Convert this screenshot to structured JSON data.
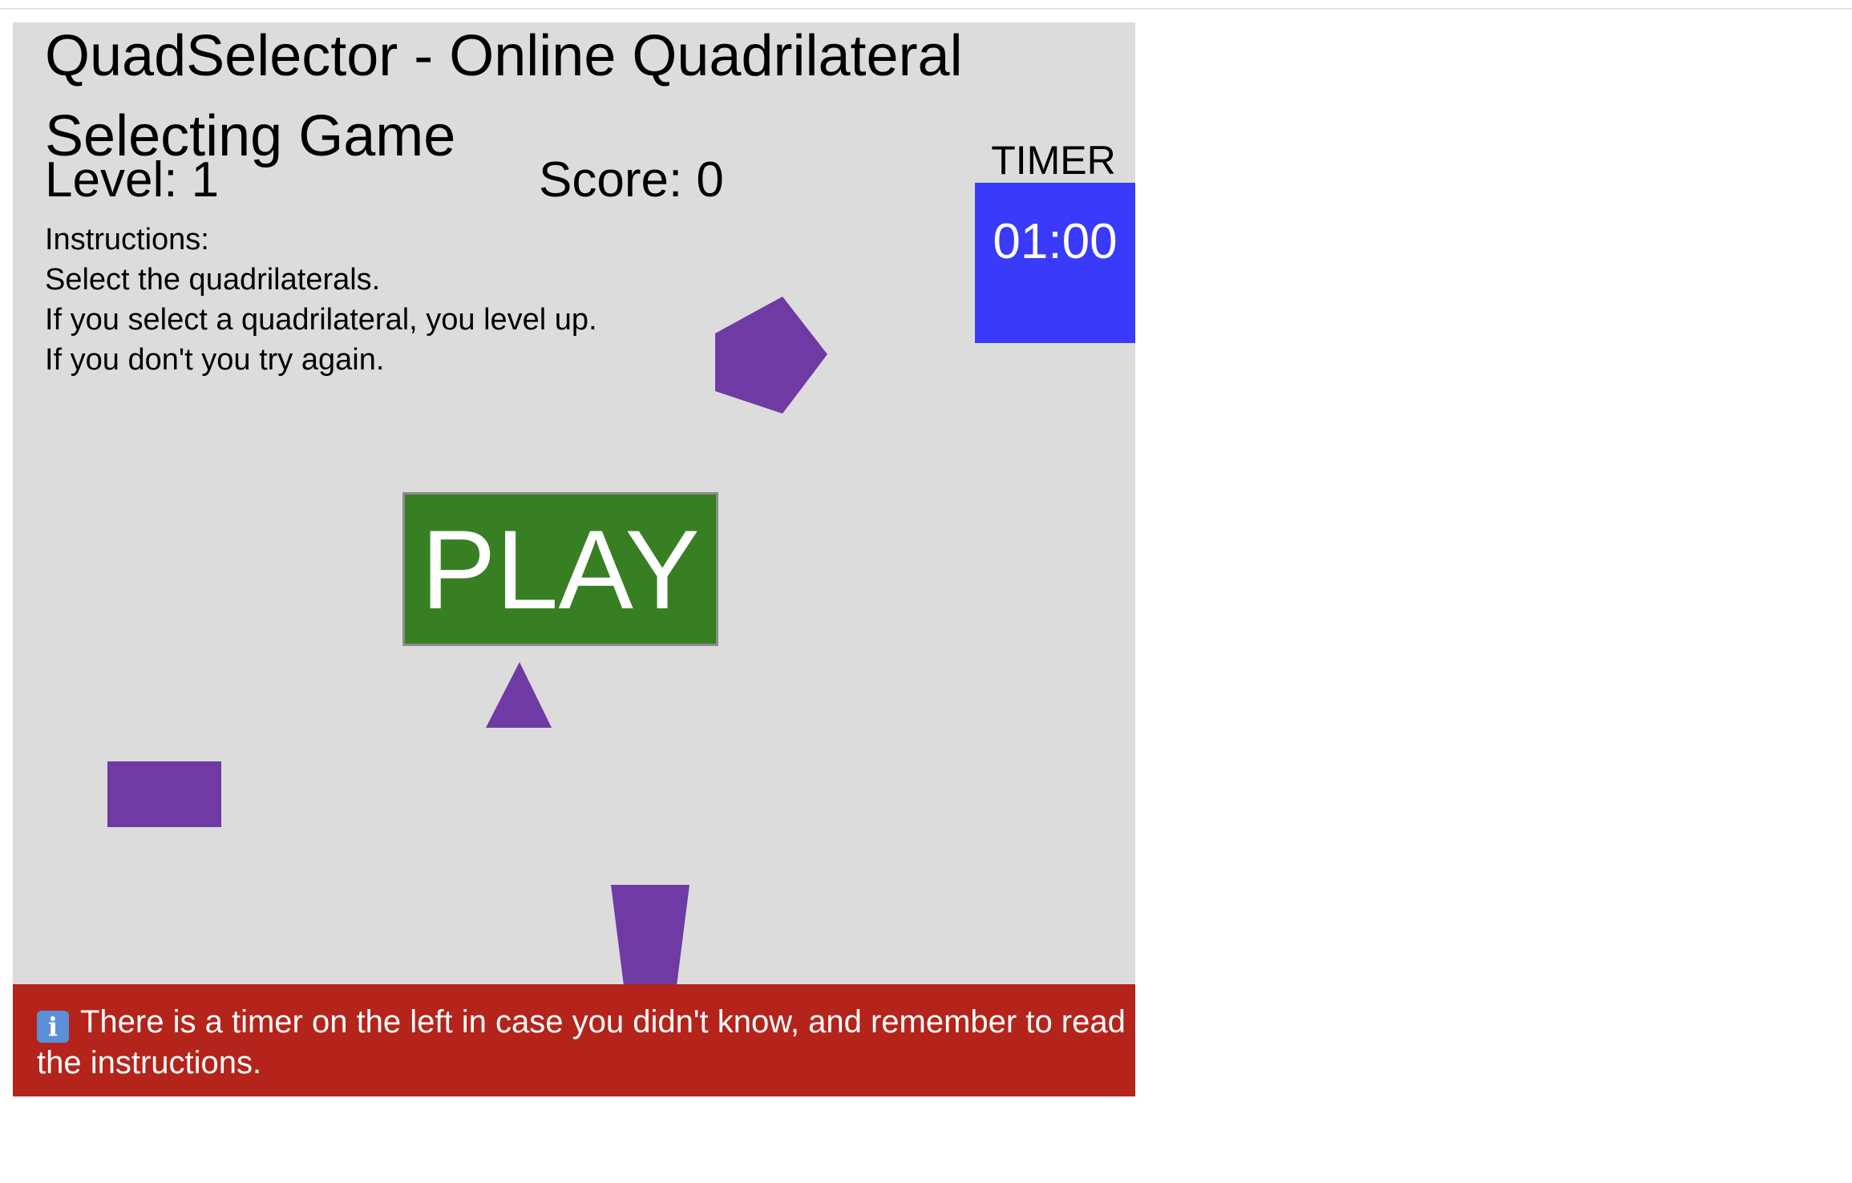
{
  "game": {
    "title": "QuadSelector - Online Quadrilateral Selecting Game",
    "level_text": "Level: 1",
    "score_text": "Score: 0",
    "instructions": [
      "Instructions:",
      "Select the quadrilaterals.",
      "If you select a quadrilateral, you level up.",
      "If you don't you try again."
    ],
    "timer_label": "TIMER",
    "timer_value": "01:00",
    "play_label": "PLAY",
    "shape_color": "#6f3aa3",
    "shapes": [
      "pentagon",
      "triangle",
      "rectangle",
      "trapezoid"
    ]
  },
  "banner": {
    "icon": "info-icon",
    "icon_glyph": "i",
    "message": "There is a timer on the left in case you didn't know, and remember to read the instructions."
  },
  "colors": {
    "background": "#dcdcdc",
    "timer_box": "#3a3afa",
    "play_button": "#387f24",
    "banner": "#b4241b"
  }
}
